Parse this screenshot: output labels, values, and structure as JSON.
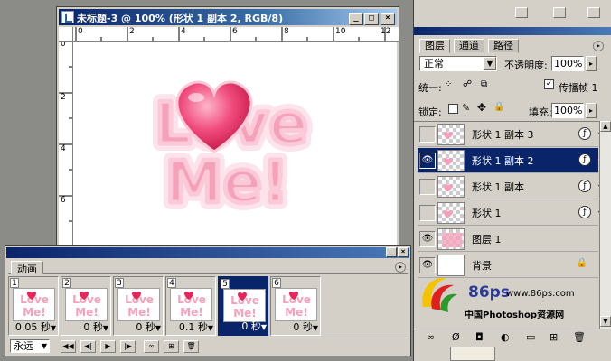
{
  "doc_window": {
    "title": "未标题-3 @ 100% (形状 1 副本 2, RGB/8)",
    "controls": {
      "minimize": "_",
      "maximize": "□",
      "close": "×"
    },
    "ruler_h": [
      "0",
      "2",
      "4",
      "6",
      "8",
      "10",
      "12"
    ],
    "ruler_v": [
      "0",
      "2",
      "4",
      "6"
    ]
  },
  "artwork": {
    "line1": "Love",
    "line2": "Me!",
    "pink": "#f7a9c0",
    "heart": "#e8245a"
  },
  "animation": {
    "panel_title": "动画",
    "frames": [
      {
        "num": "1",
        "delay": "0.05 秒"
      },
      {
        "num": "2",
        "delay": "0 秒"
      },
      {
        "num": "3",
        "delay": "0 秒"
      },
      {
        "num": "4",
        "delay": "0.1 秒"
      },
      {
        "num": "5",
        "delay": "0 秒",
        "selected": true
      },
      {
        "num": "6",
        "delay": "0 秒"
      }
    ],
    "loop": "永远",
    "controls": {
      "first": "◀◀",
      "prev": "◀|",
      "play": "▶",
      "next": "|▶",
      "tween": "∞",
      "new": "⊞",
      "delete": "🗑"
    }
  },
  "layers_panel": {
    "tabs": [
      "图层",
      "通道",
      "路径"
    ],
    "blend_mode": "正常",
    "opacity_label": "不透明度:",
    "opacity": "100%",
    "unify_label": "统一:",
    "propagate_label": "传播帧 1",
    "lock_label": "锁定:",
    "fill_label": "填充:",
    "fill": "100%",
    "layers": [
      {
        "name": "形状 1 副本 3",
        "visible": false,
        "fx": true
      },
      {
        "name": "形状 1 副本 2",
        "visible": true,
        "fx": true,
        "selected": true
      },
      {
        "name": "形状 1 副本",
        "visible": false,
        "fx": true
      },
      {
        "name": "形状 1",
        "visible": false,
        "fx": true
      },
      {
        "name": "图层 1",
        "visible": true,
        "fx": false
      },
      {
        "name": "背景",
        "visible": true,
        "fx": false,
        "locked": true
      }
    ]
  },
  "watermark": {
    "site": "www.86ps.com",
    "name": "中国Photoshop资源网",
    "logo": "86ps"
  },
  "colors": {
    "accent": "#0a246a",
    "panel": "#d4d0c8",
    "pink": "#f7a9c0"
  }
}
